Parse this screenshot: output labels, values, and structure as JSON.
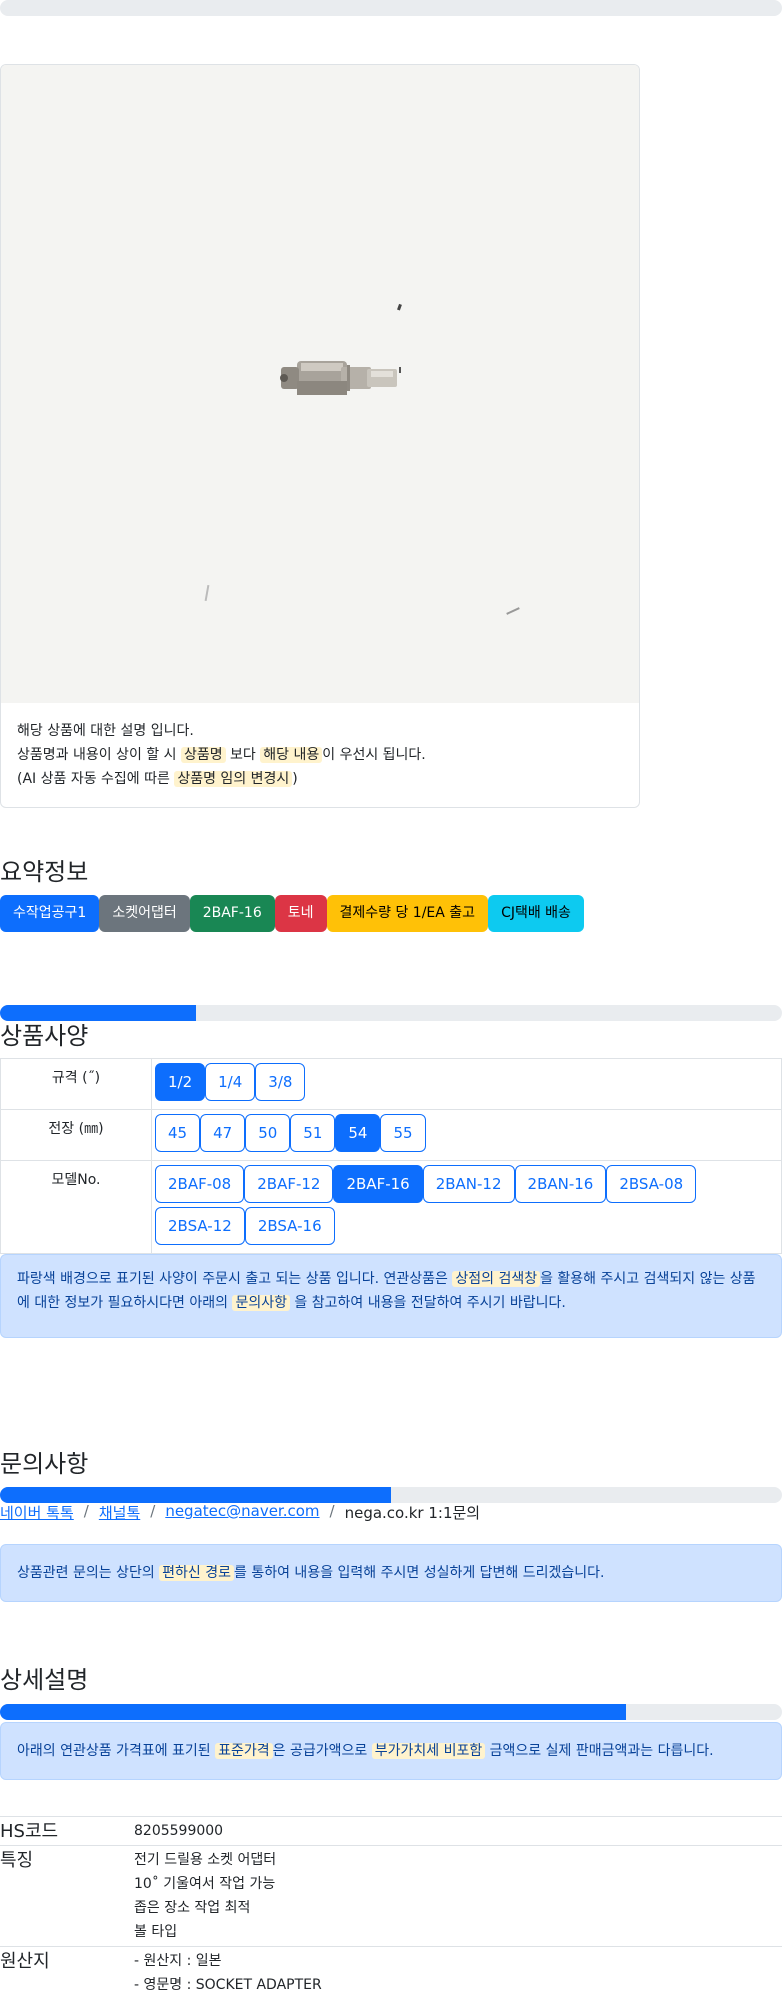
{
  "card": {
    "line1": "해당 상품에 대한 설명 입니다.",
    "line2_a": "상품명과 내용이 상이 할 시 ",
    "line2_hl1": "상품명",
    "line2_b": " 보다 ",
    "line2_hl2": "해당 내용",
    "line2_c": "이 우선시 됩니다.",
    "line3_a": "(AI 상품 자동 수집에 따른 ",
    "line3_hl": "상품명 임의 변경시",
    "line3_b": ")"
  },
  "summary": {
    "title": "요약정보",
    "badges": [
      {
        "label": "수작업공구1",
        "color": "#0d6efd"
      },
      {
        "label": "소켓어댑터",
        "color": "#6c757d"
      },
      {
        "label": "2BAF-16",
        "color": "#198754"
      },
      {
        "label": "토네",
        "color": "#dc3545"
      },
      {
        "label": "결제수량 당 1/EA 출고",
        "color": "#ffc107"
      },
      {
        "label": "CJ택배 배송",
        "color": "#0dcaf0"
      }
    ]
  },
  "spec": {
    "title": "상품사양",
    "progress": 0.25,
    "rows": [
      {
        "label": "규격 (˝)",
        "options": [
          "1/2",
          "1/4",
          "3/8"
        ],
        "selected": "1/2"
      },
      {
        "label": "전장 (㎜)",
        "options": [
          "45",
          "47",
          "50",
          "51",
          "54",
          "55"
        ],
        "selected": "54"
      },
      {
        "label": "모델No.",
        "options": [
          "2BAF-08",
          "2BAF-12",
          "2BAF-16",
          "2BAN-12",
          "2BAN-16",
          "2BSA-08",
          "2BSA-12",
          "2BSA-16"
        ],
        "selected": "2BAF-16"
      }
    ],
    "notice_a": "파랑색 배경으로 표기된 사양이 주문시 출고 되는 상품 입니다. 연관상품은 ",
    "notice_hl1": "상점의 검색창",
    "notice_b": "을 활용해 주시고 검색되지 않는 상품에 대한 정보가 필요하시다면 아래의 ",
    "notice_hl2": "문의사항",
    "notice_c": " 을 참고하여 내용을 전달하여 주시기 바랍니다."
  },
  "inquiry": {
    "title": "문의사항",
    "progress": 0.5,
    "links": [
      "네이버 톡톡",
      "채널톡",
      "negatec@naver.com"
    ],
    "plain": "nega.co.kr 1:1문의",
    "separator": "/",
    "notice_a": "상품관련 문의는 상단의 ",
    "notice_hl": "편하신 경로",
    "notice_b": "를 통하여 내용을 입력해 주시면 성실하게 답변해 드리겠습니다."
  },
  "detail": {
    "title": "상세설명",
    "progress": 0.8,
    "notice_a": "아래의 연관상품 가격표에 표기된 ",
    "notice_hl1": "표준가격",
    "notice_b": "은 공급가액으로 ",
    "notice_hl2": "부가가치세 비포함",
    "notice_c": " 금액으로 실제 판매금액과는 다릅니다.",
    "rows": [
      {
        "key": "HS코드",
        "values": [
          "8205599000"
        ]
      },
      {
        "key": "특징",
        "values": [
          "전기 드릴용 소켓 어댑터",
          "10˚ 기울여서 작업 가능",
          "좁은 장소 작업 최적",
          "볼 타입"
        ]
      },
      {
        "key": "원산지",
        "values": [
          "- 원산지 : 일본",
          "- 영문명 : SOCKET ADAPTER"
        ]
      }
    ]
  }
}
